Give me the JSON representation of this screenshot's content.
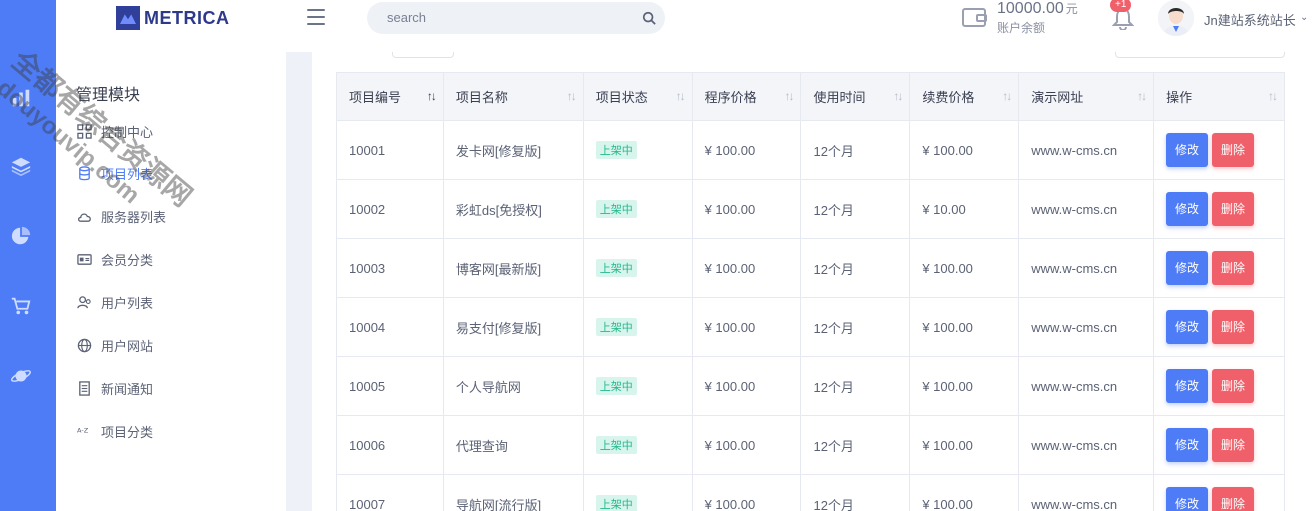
{
  "header": {
    "brand": "METRICA",
    "search_placeholder": "search",
    "balance_amount": "10000.00",
    "balance_unit": "元",
    "balance_label": "账户余额",
    "notification_badge": "+1",
    "username": "Jn建站系统站长"
  },
  "rail": {
    "icons": [
      "bar-chart-icon",
      "layers-icon",
      "pie-chart-icon",
      "cart-icon",
      "planet-icon"
    ]
  },
  "sidebar": {
    "title": "管理模块",
    "items": [
      {
        "label": "控制中心",
        "icon": "grid-icon"
      },
      {
        "label": "项目列表",
        "icon": "database-icon"
      },
      {
        "label": "服务器列表",
        "icon": "cloud-icon"
      },
      {
        "label": "会员分类",
        "icon": "card-icon"
      },
      {
        "label": "用户列表",
        "icon": "users-icon"
      },
      {
        "label": "用户网站",
        "icon": "globe-icon"
      },
      {
        "label": "新闻通知",
        "icon": "document-icon"
      },
      {
        "label": "项目分类",
        "icon": "az-icon"
      }
    ],
    "active_index": 1
  },
  "table": {
    "columns": [
      "项目编号",
      "项目名称",
      "项目状态",
      "程序价格",
      "使用时间",
      "续费价格",
      "演示网址",
      "操作"
    ],
    "edit_label": "修改",
    "delete_label": "删除",
    "rows": [
      {
        "id": "10001",
        "name": "发卡网[修复版]",
        "status": "上架中",
        "price": "¥ 100.00",
        "duration": "12个月",
        "renew": "¥ 100.00",
        "url": "www.w-cms.cn"
      },
      {
        "id": "10002",
        "name": "彩虹ds[免授权]",
        "status": "上架中",
        "price": "¥ 100.00",
        "duration": "12个月",
        "renew": "¥ 10.00",
        "url": "www.w-cms.cn"
      },
      {
        "id": "10003",
        "name": "博客网[最新版]",
        "status": "上架中",
        "price": "¥ 100.00",
        "duration": "12个月",
        "renew": "¥ 100.00",
        "url": "www.w-cms.cn"
      },
      {
        "id": "10004",
        "name": "易支付[修复版]",
        "status": "上架中",
        "price": "¥ 100.00",
        "duration": "12个月",
        "renew": "¥ 100.00",
        "url": "www.w-cms.cn"
      },
      {
        "id": "10005",
        "name": "个人导航网",
        "status": "上架中",
        "price": "¥ 100.00",
        "duration": "12个月",
        "renew": "¥ 100.00",
        "url": "www.w-cms.cn"
      },
      {
        "id": "10006",
        "name": "代理查询",
        "status": "上架中",
        "price": "¥ 100.00",
        "duration": "12个月",
        "renew": "¥ 100.00",
        "url": "www.w-cms.cn"
      },
      {
        "id": "10007",
        "name": "导航网[流行版]",
        "status": "上架中",
        "price": "¥ 100.00",
        "duration": "12个月",
        "renew": "¥ 100.00",
        "url": "www.w-cms.cn"
      }
    ]
  },
  "watermark": {
    "line1": "全都有综合资源网",
    "line2": "douyouvip.com"
  },
  "colors": {
    "accent": "#4e7cf6",
    "danger": "#f0606a",
    "success": "#25b88c"
  }
}
